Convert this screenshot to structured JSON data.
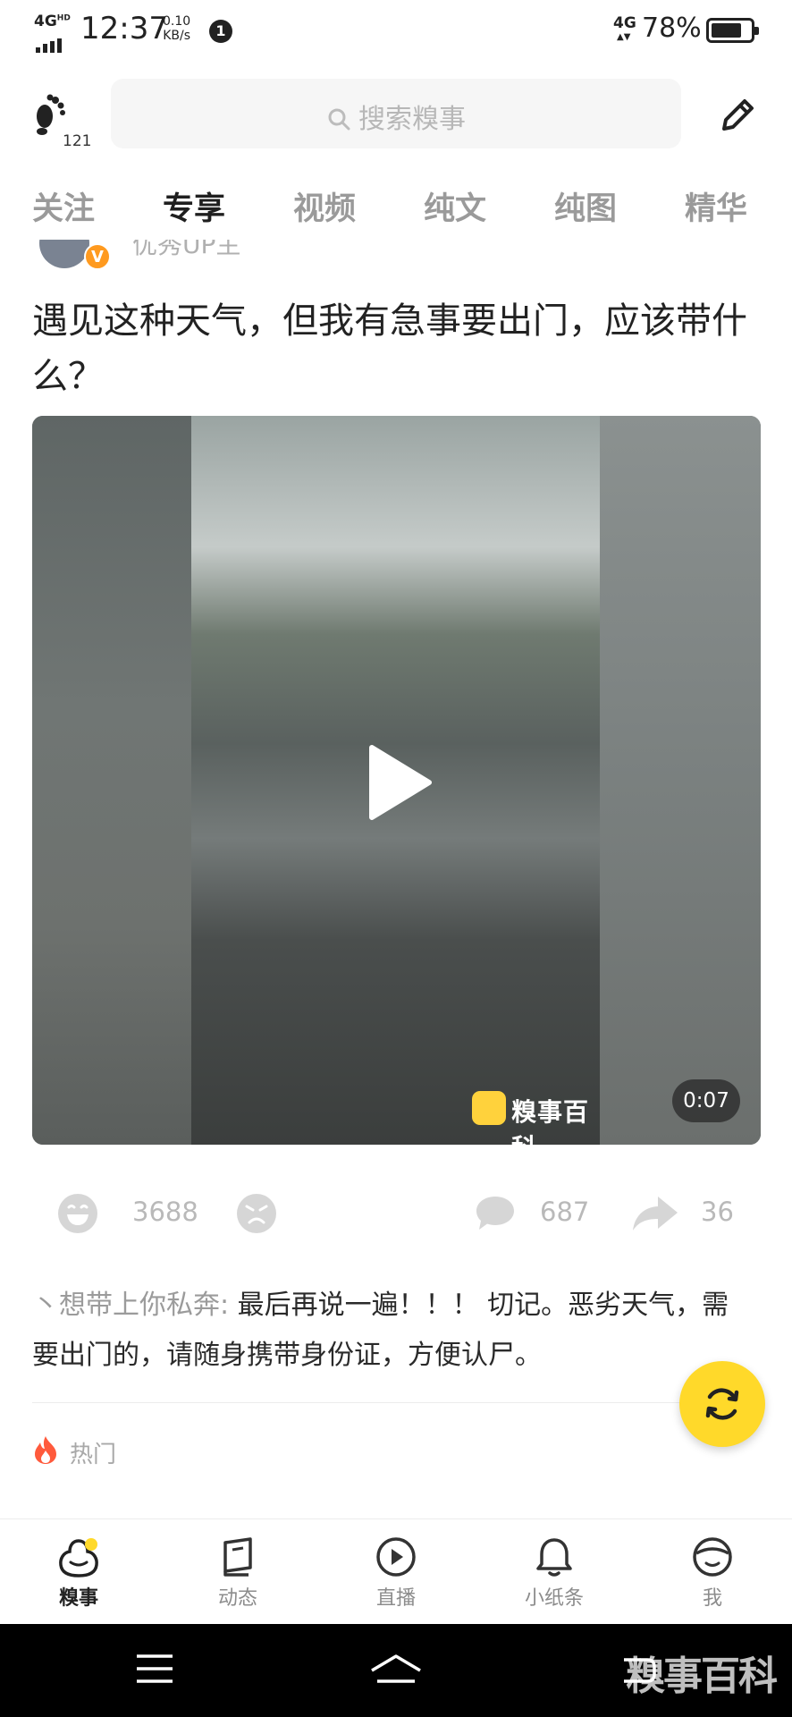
{
  "status_bar": {
    "network": "4G",
    "network_sup": "HD",
    "time": "12:37",
    "speed_value": "0.10",
    "speed_unit": "KB/s",
    "notification_count": "1",
    "mobile_data": "4G",
    "battery": "78%",
    "battery_level": 0.78
  },
  "header": {
    "footprint_count": "121",
    "search_placeholder": "搜索糗事"
  },
  "tabs": [
    {
      "label": "关注",
      "active": false
    },
    {
      "label": "专享",
      "active": true
    },
    {
      "label": "视频",
      "active": false
    },
    {
      "label": "纯文",
      "active": false
    },
    {
      "label": "纯图",
      "active": false
    },
    {
      "label": "精华",
      "active": false
    }
  ],
  "post": {
    "author": "优秀UP主",
    "badge": "V",
    "title": "遇见这种天气，但我有急事要出门，应该带什么？",
    "video_brand": "糗事百科",
    "video_duration": "0:07",
    "likes": "3688",
    "comments": "687",
    "shares": "36"
  },
  "top_comment": {
    "user": "丶想带上你私奔:",
    "text": " 最后再说一遍！！！ 切记。恶劣天气，需要出门的，请随身携带身份证，方便认尸。"
  },
  "hot_label": "热门",
  "bottom_nav": [
    {
      "label": "糗事",
      "active": true
    },
    {
      "label": "动态",
      "active": false
    },
    {
      "label": "直播",
      "active": false
    },
    {
      "label": "小纸条",
      "active": false
    },
    {
      "label": "我",
      "active": false
    }
  ],
  "watermark": "糗事百科",
  "colors": {
    "accent": "#ffd92a",
    "hot": "#ff5a3c",
    "text_muted": "#9b9b9b"
  }
}
